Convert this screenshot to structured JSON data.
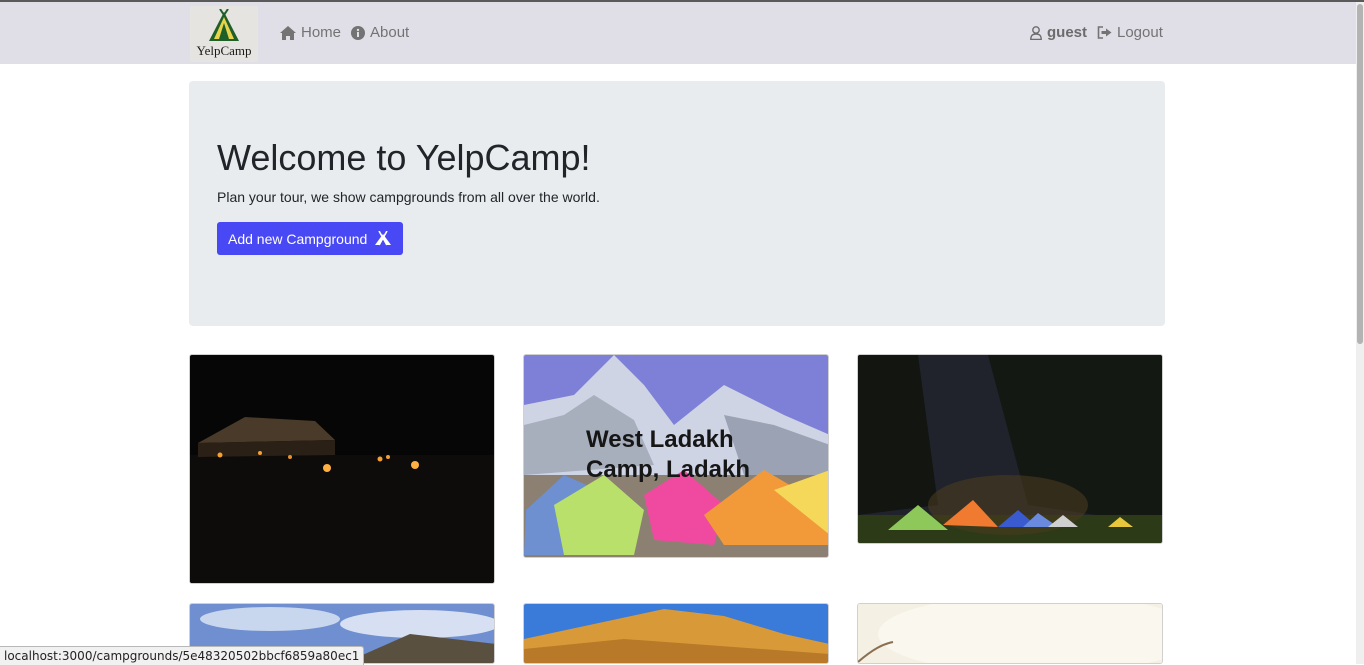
{
  "navbar": {
    "brand": "YelpCamp",
    "home": "Home",
    "about": "About",
    "user": "guest",
    "logout": "Logout",
    "icons": [
      "home-icon",
      "info-icon",
      "user-icon",
      "sign-out-icon"
    ]
  },
  "jumbotron": {
    "title": "Welcome to YelpCamp!",
    "subtitle": "Plan your tour, we show campgrounds from all over the world.",
    "button_label": "Add new Campground",
    "button_color": "#4848f5",
    "button_icon": "campground-icon"
  },
  "campgrounds": [
    {
      "caption": ""
    },
    {
      "caption": "West Ladakh Camp, Ladakh"
    },
    {
      "caption": ""
    },
    {
      "caption": ""
    },
    {
      "caption": ""
    },
    {
      "caption": ""
    }
  ],
  "status_bar": {
    "url": "localhost:3000/campgrounds/5e48320502bbcf6859a80ec1"
  }
}
